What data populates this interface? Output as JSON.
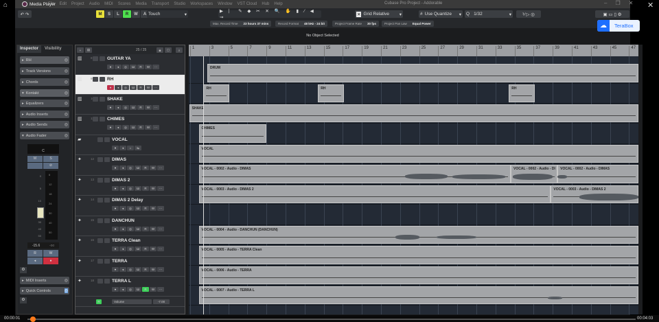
{
  "media_player": {
    "title": "Media Player",
    "time_current": "00:00:01",
    "time_total": "00:04:03",
    "progress": 0.004
  },
  "window": {
    "title": "Cubase Pro Project - Addorable"
  },
  "menu": [
    "File",
    "Edit",
    "Project",
    "Audio",
    "MIDI",
    "Scores",
    "Media",
    "Transport",
    "Studio",
    "Workspaces",
    "Window",
    "VST Cloud",
    "Hub",
    "Help"
  ],
  "toolbar": {
    "modes": [
      "M",
      "S",
      "L",
      "R",
      "W",
      "A"
    ],
    "automation_mode": "Touch",
    "snap_type": "Grid Relative",
    "quantize_mode": "Use Quantize",
    "quantize_label": "Q",
    "quantize_value": "1/32"
  },
  "info": [
    {
      "label": "Max. Record Time",
      "value": "23 hours 37 mins"
    },
    {
      "label": "Record Format",
      "value": "48 kHz - 24 bit"
    },
    {
      "label": "Project Frame Rate",
      "value": "30 fps"
    },
    {
      "label": "Project Pan Law",
      "value": "Equal Power"
    }
  ],
  "status": "No Object Selected",
  "terabox": "TeraBox",
  "inspector": {
    "tabs": [
      "Inspector",
      "Visibility"
    ],
    "track_name": "RH",
    "sections": [
      "Track Versions",
      "Chords"
    ],
    "instrument": "Kontakt",
    "sections2": [
      "Equalizers",
      "Audio Inserts",
      "Audio Sends",
      "Audio Fader"
    ],
    "pan": "C",
    "fader_scale": [
      "0",
      "5",
      "10",
      "15",
      "20",
      "30",
      "40",
      "50"
    ],
    "meter_scale": [
      "6",
      "12",
      "18",
      "24",
      "30",
      "40",
      "50"
    ],
    "volume_readout": "-15.6",
    "peak_readout": "-oo",
    "buttons": [
      "M",
      "S",
      "R",
      "W"
    ],
    "sections3": [
      "MIDI Inserts",
      "Quick Controls"
    ]
  },
  "tracklist": {
    "count": "25 / 25",
    "tracks": [
      {
        "num": "8",
        "name": "GUITAR YA",
        "type": "midi"
      },
      {
        "num": "9",
        "name": "RH",
        "type": "midi",
        "selected": true
      },
      {
        "num": "10",
        "name": "SHAKE",
        "type": "midi"
      },
      {
        "num": "11",
        "name": "CHIMES",
        "type": "midi"
      },
      {
        "num": "",
        "name": "VOCAL",
        "type": "folder"
      },
      {
        "num": "12",
        "name": "DIMAS",
        "type": "audio"
      },
      {
        "num": "13",
        "name": "DIMAS 2",
        "type": "audio"
      },
      {
        "num": "14",
        "name": "DIMAS 2 Delay",
        "type": "audio"
      },
      {
        "num": "15",
        "name": "DANCHUN",
        "type": "audio"
      },
      {
        "num": "16",
        "name": "TERRA Clean",
        "type": "audio"
      },
      {
        "num": "17",
        "name": "TERRA",
        "type": "audio"
      },
      {
        "num": "18",
        "name": "TERRA L",
        "type": "audio"
      }
    ],
    "automation": {
      "param": "Volume",
      "value": "-7.00"
    }
  },
  "ruler": [
    "1",
    "3",
    "5",
    "7",
    "9",
    "11",
    "13",
    "15",
    "17",
    "19",
    "21",
    "23",
    "25",
    "27",
    "29",
    "31",
    "33",
    "35",
    "37",
    "39",
    "41",
    "43",
    "45",
    "47"
  ],
  "regions": [
    {
      "lane": 0,
      "label": "DRUM",
      "start": 2.8,
      "end": 48
    },
    {
      "lane": 1,
      "label": "RH",
      "start": 2.4,
      "end": 5.1
    },
    {
      "lane": 1,
      "label": "RH",
      "start": 14.4,
      "end": 17.1
    },
    {
      "lane": 1,
      "label": "RH",
      "start": 34.4,
      "end": 37.1
    },
    {
      "lane": 2,
      "label": "SHAKE",
      "start": 0.9,
      "end": 48
    },
    {
      "lane": 3,
      "label": "CHIMES",
      "start": 1.9,
      "end": 9
    },
    {
      "lane": 4,
      "label": "VOCAL",
      "start": 1.9,
      "end": 48
    },
    {
      "lane": 5,
      "label": "VOCAL - 0002 - Audio - DIMAS",
      "start": 1.9,
      "end": 34.6
    },
    {
      "lane": 5,
      "label": "VOCAL - 0002 - Audio - DI",
      "start": 34.6,
      "end": 39.5
    },
    {
      "lane": 5,
      "label": "VOCAL - 0002 - Audio - DIMAS",
      "start": 39.5,
      "end": 48
    },
    {
      "lane": 6,
      "label": "VOCAL - 0003 - Audio - DIMAS 2",
      "start": 1.9,
      "end": 38.8
    },
    {
      "lane": 6,
      "label": "VOCAL - 0003 - Audio - DIMAS 2",
      "start": 38.8,
      "end": 48
    },
    {
      "lane": 8,
      "label": "VOCAL - 0004 - Audio - DANCHUN (DANCHUN)",
      "start": 1.9,
      "end": 48
    },
    {
      "lane": 9,
      "label": "VOCAL - 0005 - Audio - TERRA Clean",
      "start": 1.9,
      "end": 48
    },
    {
      "lane": 10,
      "label": "VOCAL - 0006 - Audio - TERRA",
      "start": 1.9,
      "end": 48
    },
    {
      "lane": 11,
      "label": "VOCAL - 0007 - Audio - TERRA L",
      "start": 1.9,
      "end": 48
    }
  ]
}
